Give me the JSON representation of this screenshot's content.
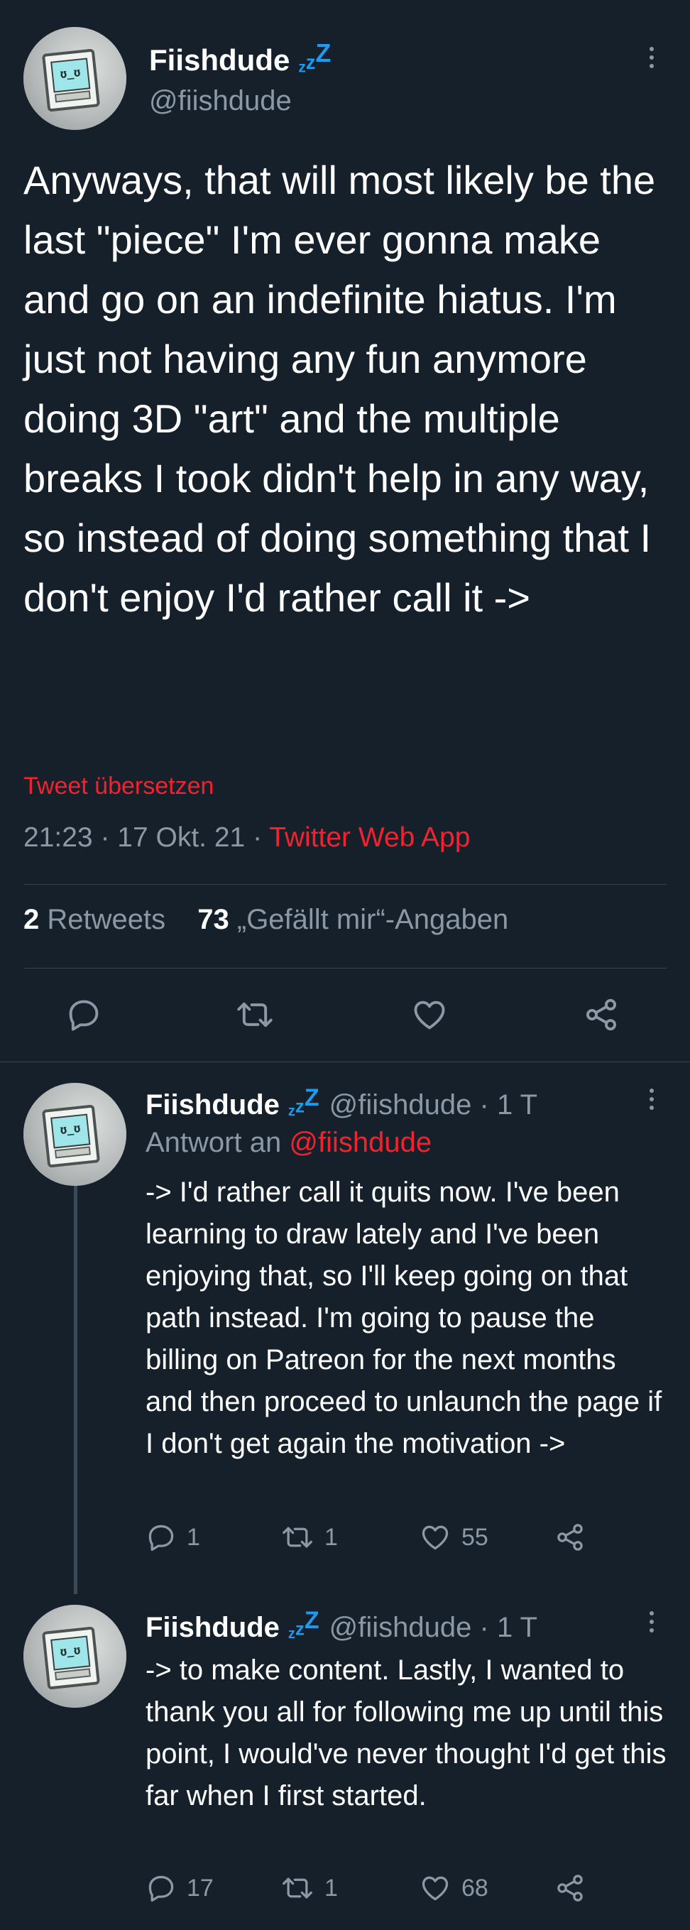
{
  "main_tweet": {
    "display_name": "Fiishdude",
    "name_badge": "zzZ",
    "handle": "@fiishdude",
    "text": "Anyways, that will most likely be the last \"piece\" I'm ever gonna make and go on an indefinite hiatus. I'm just not having any fun anymore doing 3D \"art\" and the multiple breaks I took didn't help in any way, so instead of doing something that I don't enjoy I'd rather call it ->",
    "translate_label": "Tweet übersetzen",
    "time": "21:23",
    "date": "17 Okt. 21",
    "source": "Twitter Web App",
    "retweets_count": "2",
    "retweets_label": "Retweets",
    "likes_count": "73",
    "likes_label": "„Gefällt mir“-Angaben",
    "icons": [
      "reply-icon",
      "retweet-icon",
      "like-icon",
      "share-icon",
      "more-icon"
    ]
  },
  "replies": [
    {
      "display_name": "Fiishdude",
      "name_badge": "zzZ",
      "handle_time": "@fiishdude · 1 T",
      "reply_to_prefix": "Antwort an",
      "reply_to_handle": "@fiishdude",
      "text": "-> I'd rather call it quits now. I've been learning to draw lately and I've been enjoying that, so I'll keep going on that path instead. I'm going to pause the billing on Patreon for the next months and then proceed to unlaunch the page if I don't get again the motivation ->",
      "reply_count": "1",
      "retweet_count": "1",
      "like_count": "55"
    },
    {
      "display_name": "Fiishdude",
      "name_badge": "zzZ",
      "handle_time": "@fiishdude · 1 T",
      "text": "-> to make content. Lastly, I wanted to thank you all for following me up until this point, I would've never thought I'd get this far when I first started.",
      "reply_count": "17",
      "retweet_count": "1",
      "like_count": "68"
    }
  ],
  "colors": {
    "background": "#15202b",
    "text": "#ffffff",
    "secondary": "#8b98a5",
    "accent_red": "#f4212e",
    "badge_blue": "#1d9bf0",
    "divider": "#38444d"
  }
}
